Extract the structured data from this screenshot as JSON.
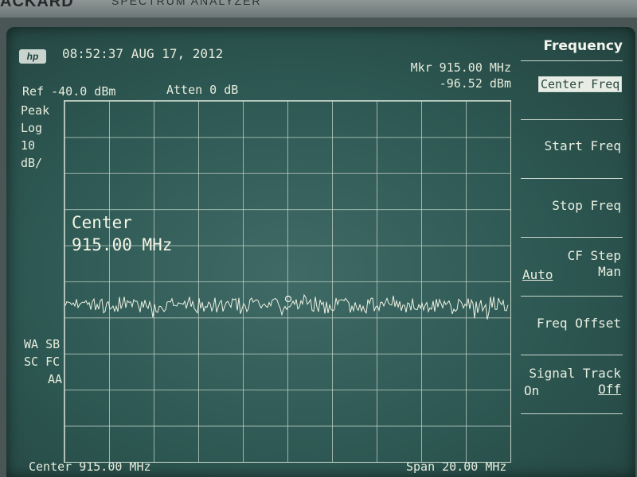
{
  "bezel": {
    "brand": "ACKARD",
    "model": "SPECTRUM ANALYZER"
  },
  "header": {
    "logo": "hp",
    "timestamp": "08:52:37 AUG 17, 2012",
    "marker_freq": "Mkr 915.00 MHz",
    "marker_level": "-96.52 dBm"
  },
  "settings": {
    "ref": "Ref -40.0 dBm",
    "atten": "Atten 0 dB",
    "detector": "Peak",
    "scale_type": "Log",
    "scale_value": "10",
    "scale_unit": "dB/"
  },
  "status": {
    "line1": "WA SB",
    "line2": "SC FC",
    "line3": "AA"
  },
  "center_annotation": {
    "label": "Center",
    "value": "915.00 MHz"
  },
  "footer": {
    "center": "Center 915.00 MHz",
    "span": "Span 20.00 MHz"
  },
  "softkeys": {
    "title": "Frequency",
    "center_freq": "Center Freq",
    "start_freq": "Start Freq",
    "stop_freq": "Stop Freq",
    "cf_step": "CF Step",
    "cf_step_auto": "Auto",
    "cf_step_man": "Man",
    "freq_offset": "Freq Offset",
    "signal_track": "Signal Track",
    "signal_track_on": "On",
    "signal_track_off": "Off"
  },
  "colors": {
    "screen": "#2d5752",
    "trace": "#eef2e2",
    "grid": "#c3d2c8",
    "text": "#e6ecdc"
  }
}
